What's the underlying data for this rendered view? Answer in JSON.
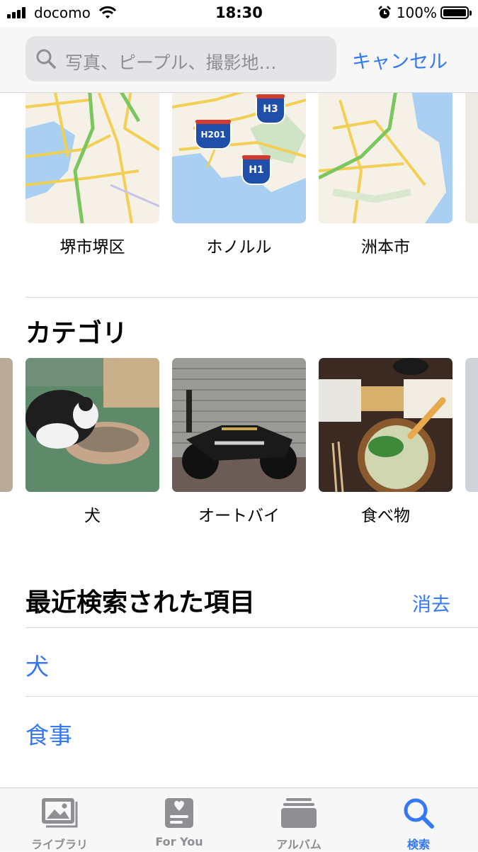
{
  "status_bar": {
    "carrier": "docomo",
    "time": "18:30",
    "battery": "100%"
  },
  "search": {
    "placeholder": "写真、ピープル、撮影地…",
    "cancel_label": "キャンセル"
  },
  "places": [
    {
      "label": "堺市堺区"
    },
    {
      "label": "ホノルル"
    },
    {
      "label": "洲本市"
    }
  ],
  "map_shields": [
    "H3",
    "H201",
    "H1"
  ],
  "categories": {
    "title": "カテゴリ",
    "items": [
      {
        "label": "犬"
      },
      {
        "label": "オートバイ"
      },
      {
        "label": "食べ物"
      }
    ]
  },
  "recent": {
    "title": "最近検索された項目",
    "clear_label": "消去",
    "items": [
      "犬",
      "食事"
    ]
  },
  "tabs": [
    {
      "label": "ライブラリ",
      "icon": "photo-library-icon",
      "active": false
    },
    {
      "label": "For You",
      "icon": "for-you-icon",
      "active": false
    },
    {
      "label": "アルバム",
      "icon": "album-icon",
      "active": false
    },
    {
      "label": "検索",
      "icon": "search-icon",
      "active": true
    }
  ],
  "colors": {
    "accent": "#3478f6",
    "inactive": "#8e8e93",
    "map_water": "#a9d0f2",
    "map_land": "#f5f1e6",
    "map_road": "#f2cf55",
    "map_highway": "#7bc65f"
  }
}
